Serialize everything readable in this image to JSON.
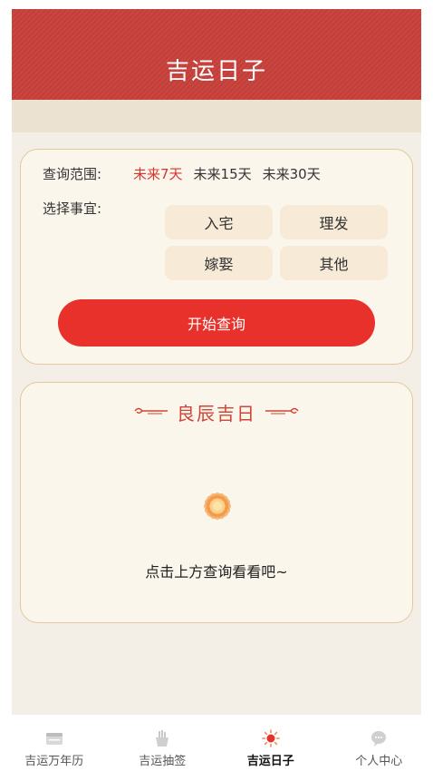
{
  "header": {
    "title": "吉运日子"
  },
  "query": {
    "range_label": "查询范围:",
    "ranges": [
      {
        "label": "未来7天",
        "active": true
      },
      {
        "label": "未来15天",
        "active": false
      },
      {
        "label": "未来30天",
        "active": false
      }
    ],
    "matter_label": "选择事宜:",
    "matters": [
      "入宅",
      "理发",
      "嫁娶",
      "其他"
    ],
    "start_button": "开始查询"
  },
  "result": {
    "title": "良辰吉日",
    "empty_text": "点击上方查询看看吧~",
    "flower_icon": "chrysanthemum-icon"
  },
  "tabbar": {
    "tabs": [
      {
        "label": "吉运万年历",
        "icon": "calendar-icon",
        "active": false
      },
      {
        "label": "吉运抽签",
        "icon": "lot-tube-icon",
        "active": false
      },
      {
        "label": "吉运日子",
        "icon": "sun-icon",
        "active": true
      },
      {
        "label": "个人中心",
        "icon": "chat-bubble-icon",
        "active": false
      }
    ]
  },
  "colors": {
    "header_bg": "#c8403a",
    "accent_red": "#e8312b",
    "active_text": "#d9352f",
    "card_border": "#e2c9a0",
    "tag_bg": "#f7ead6"
  }
}
